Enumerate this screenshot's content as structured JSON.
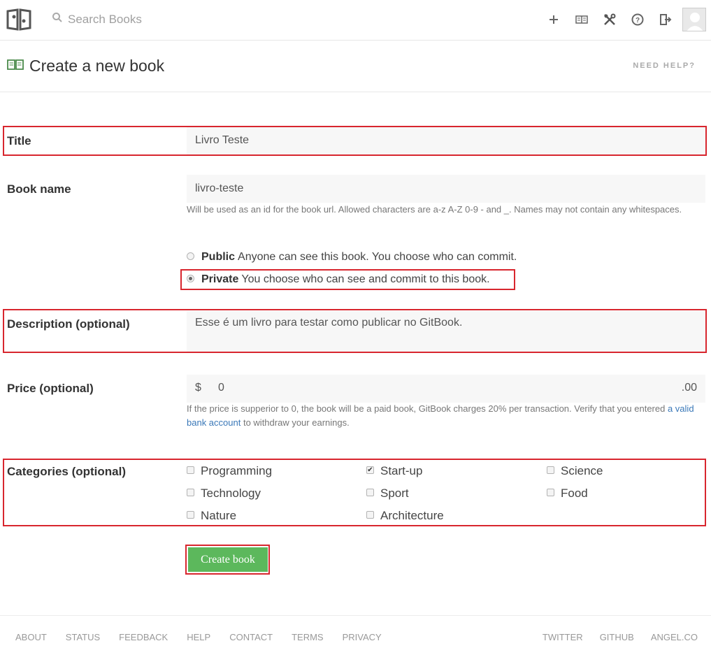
{
  "nav": {
    "search_placeholder": "Search Books",
    "icons": [
      "plus-icon",
      "book-icon",
      "tools-icon",
      "help-icon",
      "sign-out-icon"
    ]
  },
  "header": {
    "title": "Create a new book",
    "help_link": "NEED HELP?"
  },
  "form": {
    "title": {
      "label": "Title",
      "value": "Livro Teste"
    },
    "book_name": {
      "label": "Book name",
      "value": "livro-teste",
      "hint": "Will be used as an id for the book url. Allowed characters are a-z A-Z 0-9 - and _. Names may not contain any whitespaces."
    },
    "visibility": {
      "public_title": "Public",
      "public_desc": "Anyone can see this book. You choose who can commit.",
      "private_title": "Private",
      "private_desc": "You choose who can see and commit to this book.",
      "selected": "private"
    },
    "description": {
      "label": "Description (optional)",
      "value": "Esse é um livro para testar como publicar no GitBook."
    },
    "price": {
      "label": "Price (optional)",
      "currency": "$",
      "value": "0",
      "cents": ".00",
      "hint_prefix": "If the price is supperior to 0, the book will be a paid book, GitBook charges 20% per transaction. Verify that you entered",
      "hint_link": "a valid bank account",
      "hint_suffix": "to withdraw your earnings."
    },
    "categories": {
      "label": "Categories (optional)",
      "items": [
        {
          "name": "Programming",
          "checked": false
        },
        {
          "name": "Start-up",
          "checked": true
        },
        {
          "name": "Science",
          "checked": false
        },
        {
          "name": "Technology",
          "checked": false
        },
        {
          "name": "Sport",
          "checked": false
        },
        {
          "name": "Food",
          "checked": false
        },
        {
          "name": "Nature",
          "checked": false
        },
        {
          "name": "Architecture",
          "checked": false
        }
      ]
    },
    "submit_label": "Create book"
  },
  "footer": {
    "left": [
      "ABOUT",
      "STATUS",
      "FEEDBACK",
      "HELP",
      "CONTACT",
      "TERMS",
      "PRIVACY"
    ],
    "right": [
      "TWITTER",
      "GITHUB",
      "ANGEL.CO"
    ]
  },
  "colors": {
    "highlight": "#d8262e",
    "button": "#5cb85c",
    "link": "#3a78b8"
  }
}
